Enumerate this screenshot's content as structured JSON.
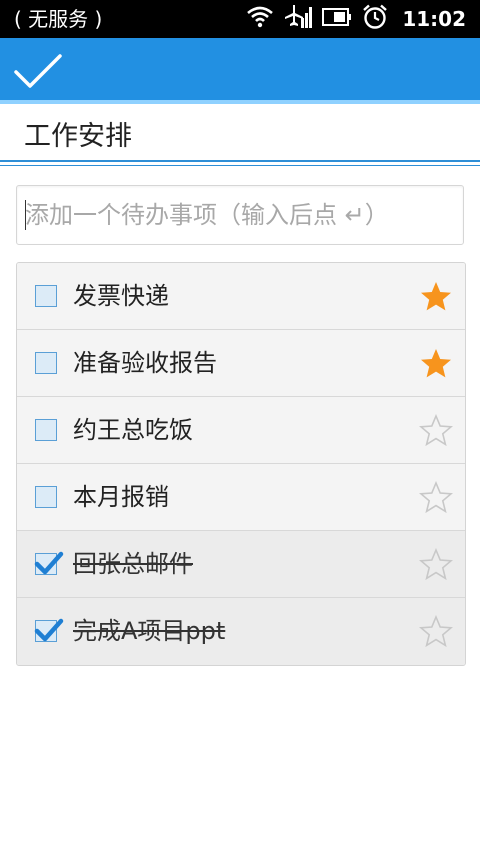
{
  "statusbar": {
    "carrier": "( 无服务 )",
    "time": "11:02",
    "icons": [
      "wifi-icon",
      "airplane-mode-icon",
      "battery-icon",
      "alarm-icon"
    ]
  },
  "actionbar": {
    "done_icon": "checkmark-icon"
  },
  "page": {
    "title": "工作安排"
  },
  "new_todo": {
    "placeholder": "添加一个待办事项（输入后点 ↵）",
    "value": ""
  },
  "todos": [
    {
      "label": "发票快递",
      "done": false,
      "starred": true
    },
    {
      "label": "准备验收报告",
      "done": false,
      "starred": true
    },
    {
      "label": "约王总吃饭",
      "done": false,
      "starred": false
    },
    {
      "label": "本月报销",
      "done": false,
      "starred": false
    },
    {
      "label": "回张总邮件",
      "done": true,
      "starred": false
    },
    {
      "label": "完成A项目ppt",
      "done": true,
      "starred": false
    }
  ],
  "colors": {
    "accent": "#2290e2",
    "star_on": "#f7941d",
    "star_off": "#c8c8c8",
    "checkbox_border": "#5a9fd6",
    "checkbox_fill": "#dcebf7",
    "check_mark": "#1f7fd3"
  }
}
